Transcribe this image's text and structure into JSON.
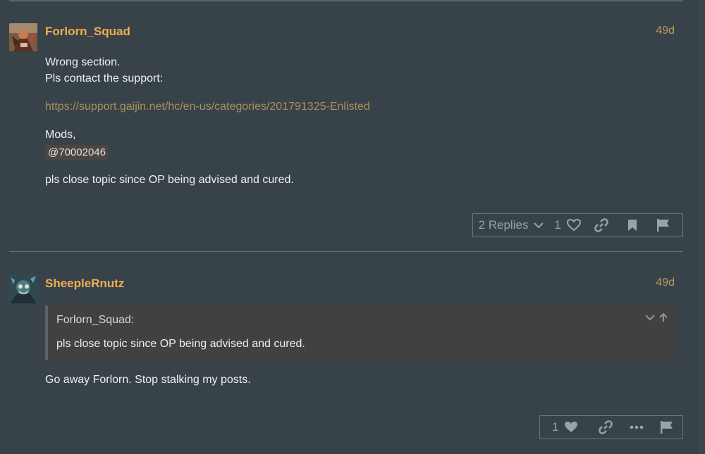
{
  "posts": [
    {
      "username": "Forlorn_Squad",
      "age": "49d",
      "lines": [
        "Wrong section.",
        "Pls contact the support:"
      ],
      "link": "https://support.gaijin.net/hc/en-us/categories/201791325-Enlisted",
      "mods_label": "Mods,",
      "mention": "@70002046",
      "closing": "pls close topic since OP being advised and cured.",
      "actions": {
        "replies_label": "2 Replies",
        "like_count": "1"
      }
    },
    {
      "username": "SheepleRnutz",
      "age": "49d",
      "quote": {
        "title": "Forlorn_Squad:",
        "text": "pls close topic since OP being advised and cured."
      },
      "text": "Go away Forlorn. Stop stalking my posts.",
      "actions": {
        "like_count": "1"
      }
    }
  ],
  "icons": {
    "reply_chevron": "chevron-down-icon",
    "like": "heart-icon",
    "link": "link-icon",
    "bookmark": "bookmark-icon",
    "flag": "flag-icon",
    "more": "ellipsis-icon",
    "quote_expand": "chevron-down-icon",
    "quote_goto": "arrow-up-icon"
  },
  "colors": {
    "background": "#384349",
    "username": "#f0ae52",
    "age": "#b8985e",
    "link": "#a7915f",
    "icon": "#9aa3a7",
    "quote_bg": "#414141"
  }
}
